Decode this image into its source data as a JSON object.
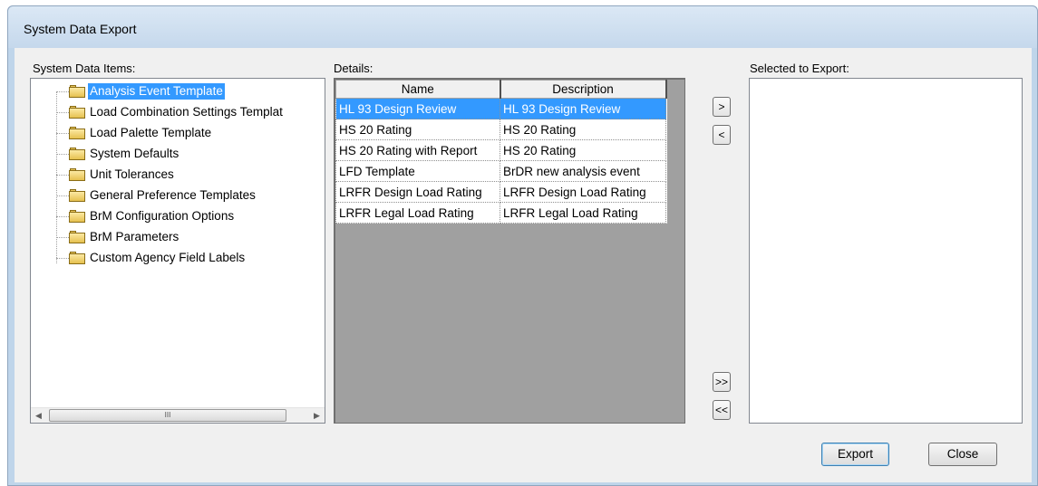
{
  "window": {
    "title": "System Data Export"
  },
  "labels": {
    "system_items": "System Data Items:",
    "details": "Details:",
    "selected": "Selected to Export:"
  },
  "tree": {
    "items": [
      {
        "label": "Analysis Event Template",
        "selected": true
      },
      {
        "label": "Load Combination Settings Templat",
        "selected": false
      },
      {
        "label": "Load Palette Template",
        "selected": false
      },
      {
        "label": "System Defaults",
        "selected": false
      },
      {
        "label": "Unit Tolerances",
        "selected": false
      },
      {
        "label": "General Preference Templates",
        "selected": false
      },
      {
        "label": "BrM Configuration Options",
        "selected": false
      },
      {
        "label": "BrM Parameters",
        "selected": false
      },
      {
        "label": "Custom Agency Field Labels",
        "selected": false
      }
    ],
    "scroll_left": "◀",
    "scroll_right": "▶",
    "scroll_thumb": "III"
  },
  "details": {
    "columns": [
      "Name",
      "Description"
    ],
    "rows": [
      {
        "name": "HL 93 Design Review",
        "description": "HL 93 Design Review",
        "selected": true
      },
      {
        "name": "HS 20 Rating",
        "description": "HS 20 Rating",
        "selected": false
      },
      {
        "name": "HS 20 Rating with Report",
        "description": "HS 20 Rating",
        "selected": false
      },
      {
        "name": "LFD Template",
        "description": "BrDR new analysis event",
        "selected": false
      },
      {
        "name": "LRFR Design Load Rating",
        "description": "LRFR Design Load Rating",
        "selected": false
      },
      {
        "name": "LRFR Legal Load Rating",
        "description": "LRFR Legal Load Rating",
        "selected": false
      }
    ]
  },
  "move_buttons": {
    "add": ">",
    "remove": "<",
    "add_all": ">>",
    "remove_all": "<<"
  },
  "buttons": {
    "export": "Export",
    "close": "Close"
  }
}
